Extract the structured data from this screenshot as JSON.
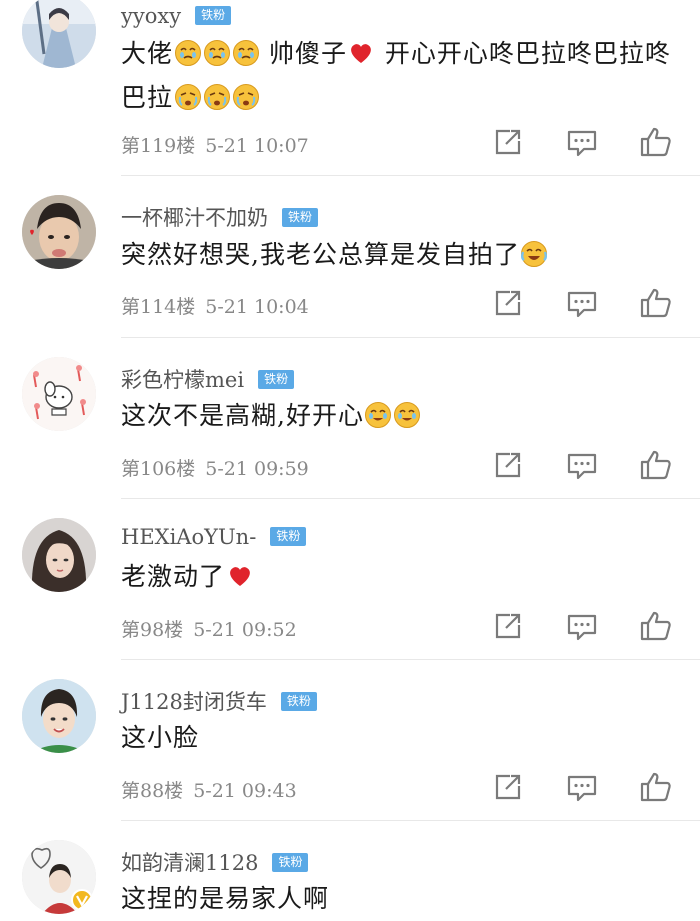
{
  "badge_label": "铁粉",
  "colors": {
    "badge": "#5aa9e6",
    "meta_text": "#888888",
    "icon": "#7a7a7a",
    "heart": "#e0242c"
  },
  "icons": {
    "share": "share-edit-icon",
    "comment": "comment-bubble-icon",
    "like": "thumbs-up-icon"
  },
  "comments": [
    {
      "username": "yyoxy",
      "text_parts": [
        "大佬",
        "",
        "",
        "",
        " 帅傻子",
        "",
        " 开心开心咚巴拉咚巴拉咚巴拉",
        "",
        "",
        ""
      ],
      "emoji_names": [
        "moved-emoji",
        "moved-emoji",
        "moved-emoji",
        "heart-emoji",
        "tears-emoji",
        "tears-emoji",
        "tears-emoji"
      ],
      "floor": "第119楼",
      "date": "5-21 10:07"
    },
    {
      "username": "一杯椰汁不加奶",
      "text": "突然好想哭,我老公总算是发自拍了",
      "emoji_names": [
        "laugh-cry-emoji"
      ],
      "floor": "第114楼",
      "date": "5-21 10:04"
    },
    {
      "username": "彩色柠檬mei",
      "text": "这次不是高糊,好开心",
      "emoji_names": [
        "happy-tears-emoji",
        "happy-tears-emoji"
      ],
      "floor": "第106楼",
      "date": "5-21 09:59"
    },
    {
      "username": "HEXiAoYUn-",
      "text": "老激动了",
      "emoji_names": [
        "heart-emoji"
      ],
      "floor": "第98楼",
      "date": "5-21 09:52"
    },
    {
      "username": "J1128封闭货车",
      "text": "这小脸",
      "floor": "第88楼",
      "date": "5-21 09:43"
    },
    {
      "username": "如韵清澜1128",
      "text": "这捏的是易家人啊"
    }
  ]
}
